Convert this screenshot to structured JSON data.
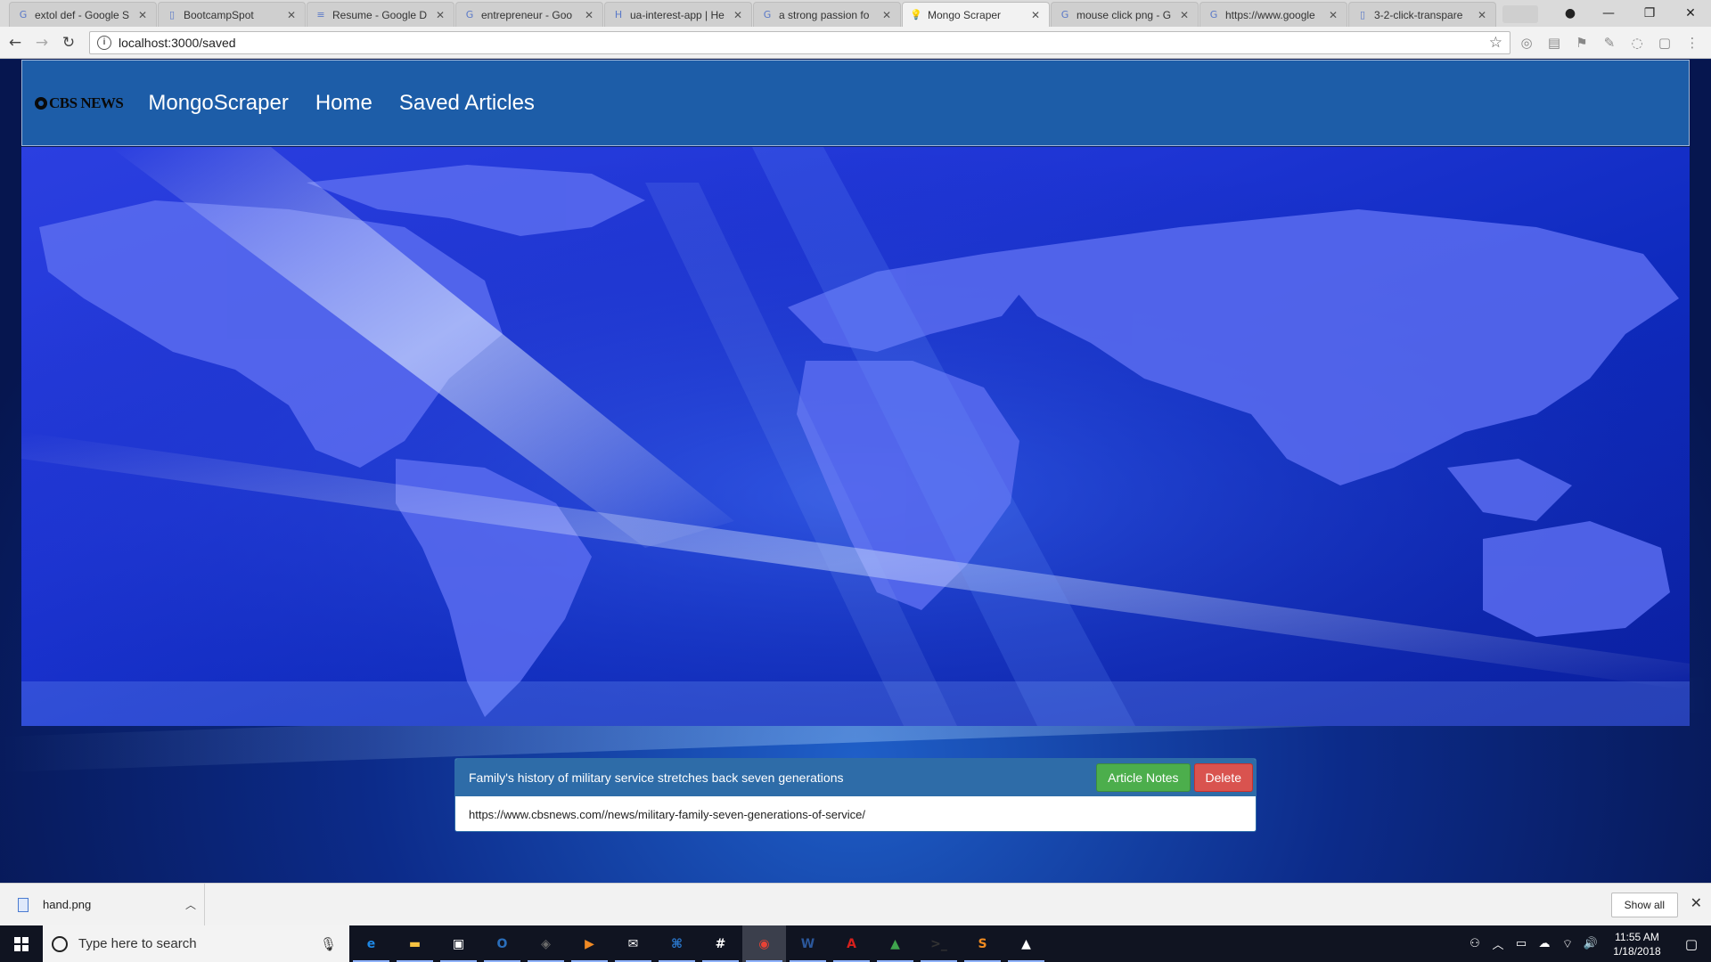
{
  "browser": {
    "tabs": [
      {
        "title": "extol def - Google S",
        "icon": "google-icon",
        "glyph": "G"
      },
      {
        "title": "BootcampSpot",
        "icon": "page-icon",
        "glyph": "▯"
      },
      {
        "title": "Resume - Google D",
        "icon": "docs-icon",
        "glyph": "≡"
      },
      {
        "title": "entrepreneur - Goo",
        "icon": "google-icon",
        "glyph": "G"
      },
      {
        "title": "ua-interest-app | He",
        "icon": "heroku-icon",
        "glyph": "H"
      },
      {
        "title": "a strong passion fo",
        "icon": "google-icon",
        "glyph": "G"
      },
      {
        "title": "Mongo Scraper",
        "icon": "bulb-icon",
        "glyph": "💡"
      },
      {
        "title": "mouse click png - G",
        "icon": "google-icon",
        "glyph": "G"
      },
      {
        "title": "https://www.google",
        "icon": "google-icon",
        "glyph": "G"
      },
      {
        "title": "3-2-click-transpare",
        "icon": "page-icon",
        "glyph": "▯"
      }
    ],
    "active_tab_index": 6,
    "url": "localhost:3000/saved"
  },
  "navbar": {
    "logo_text": "CBS NEWS",
    "brand": "MongoScraper",
    "links": [
      "Home",
      "Saved Articles"
    ]
  },
  "article": {
    "title": "Family's history of military service stretches back seven generations",
    "url": "https://www.cbsnews.com//news/military-family-seven-generations-of-service/",
    "notes_label": "Article Notes",
    "delete_label": "Delete"
  },
  "downloads": {
    "file": "hand.png",
    "show_all": "Show all"
  },
  "taskbar": {
    "search_placeholder": "Type here to search",
    "time": "11:55 AM",
    "date": "1/18/2018",
    "apps": [
      {
        "name": "edge-icon",
        "glyph": "e",
        "color": "#1e88e5"
      },
      {
        "name": "file-explorer-icon",
        "glyph": "▬",
        "color": "#f5c242"
      },
      {
        "name": "store-icon",
        "glyph": "▣",
        "color": "#ffffff"
      },
      {
        "name": "outlook-icon",
        "glyph": "O",
        "color": "#2a6ebb"
      },
      {
        "name": "git-icon",
        "glyph": "◈",
        "color": "#6c6c6c"
      },
      {
        "name": "media-player-icon",
        "glyph": "▶",
        "color": "#f08a24"
      },
      {
        "name": "mail-icon",
        "glyph": "✉",
        "color": "#ffffff"
      },
      {
        "name": "vscode-icon",
        "glyph": "⌘",
        "color": "#2b7bd3"
      },
      {
        "name": "slack-icon",
        "glyph": "#",
        "color": "#ffffff"
      },
      {
        "name": "chrome-icon",
        "glyph": "◉",
        "color": "#e94235"
      },
      {
        "name": "word-icon",
        "glyph": "W",
        "color": "#2b579a"
      },
      {
        "name": "acrobat-icon",
        "glyph": "A",
        "color": "#d7201c"
      },
      {
        "name": "robomongo-icon",
        "glyph": "▲",
        "color": "#3fa34d"
      },
      {
        "name": "terminal-icon",
        "glyph": ">_",
        "color": "#333333"
      },
      {
        "name": "sublime-icon",
        "glyph": "S",
        "color": "#ef8b21"
      },
      {
        "name": "photos-icon",
        "glyph": "▲",
        "color": "#ffffff"
      }
    ],
    "active_app_index": 9
  },
  "colors": {
    "navbar": "#1d5da8",
    "panel_header": "#2e6ca8",
    "notes_button": "#4cae4c",
    "delete_button": "#d9534f"
  }
}
